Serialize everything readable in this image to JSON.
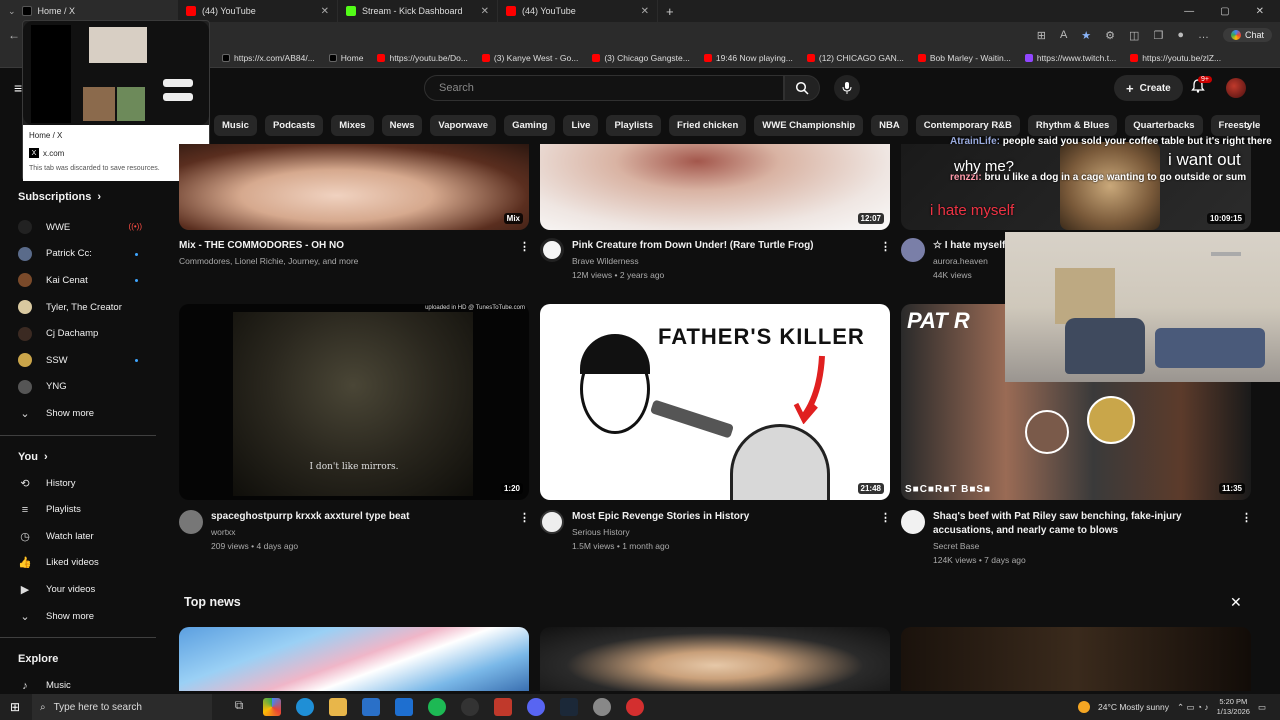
{
  "browser": {
    "tabs": [
      {
        "title": "Home / X",
        "color": "#000000"
      },
      {
        "title": "(44) YouTube",
        "color": "#ff0000"
      },
      {
        "title": "Stream - Kick Dashboard",
        "color": "#53fc18"
      },
      {
        "title": "(44) YouTube",
        "color": "#ff0000"
      }
    ],
    "chat_label": "Chat",
    "bookmarks": [
      "https://x.com/AB84/...",
      "Home",
      "https://youtu.be/Do...",
      "(3) Kanye West - Go...",
      "(3) Chicago Gangste...",
      "19:46 Now playing...",
      "(12) CHICAGO GAN...",
      "Bob Marley - Waitin...",
      "https://www.twitch.t...",
      "https://youtu.be/zlZ..."
    ]
  },
  "tab_preview": {
    "title": "Home / X",
    "domain": "x.com",
    "note": "This tab was discarded to save resources."
  },
  "header": {
    "search_placeholder": "Search",
    "create_label": "Create",
    "notif_count": "9+"
  },
  "chips": [
    "Music",
    "Podcasts",
    "Mixes",
    "News",
    "Vaporwave",
    "Gaming",
    "Live",
    "Playlists",
    "Fried chicken",
    "WWE Championship",
    "NBA",
    "Contemporary R&B",
    "Rhythm & Blues",
    "Quarterbacks",
    "Freestyle Rap"
  ],
  "sidebar": {
    "subscriptions_label": "Subscriptions",
    "subscriptions": [
      {
        "name": "WWE",
        "color": "#222222",
        "status": "live"
      },
      {
        "name": "Patrick Cc:",
        "color": "#5a6b8a",
        "status": "dot"
      },
      {
        "name": "Kai Cenat",
        "color": "#7a4a2a",
        "status": "dot"
      },
      {
        "name": "Tyler, The Creator",
        "color": "#d9c9a0",
        "status": ""
      },
      {
        "name": "Cj Dachamp",
        "color": "#3b2a22",
        "status": ""
      },
      {
        "name": "SSW",
        "color": "#caa54a",
        "status": "dot"
      },
      {
        "name": "YNG",
        "color": "#555555",
        "status": ""
      }
    ],
    "show_more_1": "Show more",
    "you_label": "You",
    "you_items": [
      {
        "label": "History",
        "icon": "history-icon",
        "glyph": "⟲"
      },
      {
        "label": "Playlists",
        "icon": "playlists-icon",
        "glyph": "≡"
      },
      {
        "label": "Watch later",
        "icon": "watch-later-icon",
        "glyph": "◷"
      },
      {
        "label": "Liked videos",
        "icon": "like-icon",
        "glyph": "👍"
      },
      {
        "label": "Your videos",
        "icon": "your-videos-icon",
        "glyph": "▶"
      }
    ],
    "show_more_2": "Show more",
    "explore_label": "Explore",
    "explore_items": [
      {
        "label": "Music",
        "icon": "music-icon",
        "glyph": "♪"
      }
    ]
  },
  "videos_row1": [
    {
      "title": "Mix - THE COMMODORES - OH NO",
      "meta1": "Commodores, Lionel Richie, Journey, and more",
      "meta2": "",
      "duration": "Mix"
    },
    {
      "title": "Pink Creature from Down Under! (Rare Turtle Frog)",
      "meta1": "Brave Wilderness",
      "meta2": "12M views • 2 years ago",
      "duration": "12:07"
    },
    {
      "title": "☆ I hate myself",
      "meta1": "aurora.heaven",
      "meta2": "44K views",
      "duration": "10:09:15"
    }
  ],
  "videos_row2": [
    {
      "title": "spaceghostpurrp krxxk axxturel type beat",
      "meta1": "wortxx",
      "meta2": "209 views • 4 days ago",
      "duration": "1:20",
      "overlay_text": "I don't like mirrors.",
      "top_text": "uploaded in HD @ TunesToTube.com"
    },
    {
      "title": "Most Epic Revenge Stories in History",
      "meta1": "Serious History",
      "meta2": "1.5M views • 1 month ago",
      "duration": "21:48",
      "overlay_text": "FATHER'S KILLER"
    },
    {
      "title": "Shaq's beef with Pat Riley saw benching, fake-injury accusations, and nearly came to blows",
      "meta1": "Secret Base",
      "meta2": "124K views • 7 days ago",
      "duration": "11:35",
      "overlay_text": "PAT R",
      "bottom_text": "S■C■R■T B■S■"
    }
  ],
  "section": {
    "title": "Top news"
  },
  "stream_chat": {
    "line1_user": "AtrainLife:",
    "line1_text": "people said you sold your coffee table but it's right there",
    "line2_user": "renzzi:",
    "line2_text": "bru u like a dog in a cage wanting to go outside or sum",
    "caption1": "i want out",
    "caption2": "why me?",
    "caption3": "i hate myself"
  },
  "taskbar": {
    "search_placeholder": "Type here to search",
    "weather": "24°C  Mostly sunny",
    "time": "5:20 PM",
    "date": "1/13/2026"
  }
}
